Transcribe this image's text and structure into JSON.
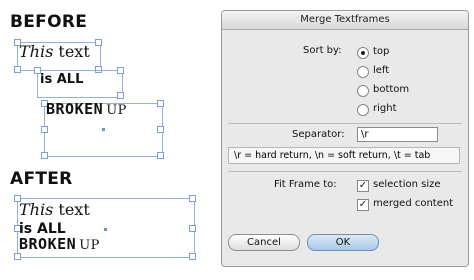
{
  "before_label": "BEFORE",
  "after_label": "AFTER",
  "sample": {
    "line1_script": "This",
    "line1_rest": " text",
    "line2": "is ALL",
    "line3_block": "BROKEN",
    "line3_up": "UP"
  },
  "dialog": {
    "title": "Merge Textframes",
    "sort_by_label": "Sort by:",
    "sort_options": [
      "top",
      "left",
      "bottom",
      "right"
    ],
    "sort_selected": "top",
    "separator_label": "Separator:",
    "separator_value": "\\r",
    "separator_hint": "\\r = hard return, \\n = soft return, \\t = tab",
    "fit_frame_label": "Fit Frame to:",
    "fit_options": [
      {
        "label": "selection size",
        "checked": true
      },
      {
        "label": "merged content",
        "checked": true
      }
    ],
    "cancel_label": "Cancel",
    "ok_label": "OK"
  }
}
